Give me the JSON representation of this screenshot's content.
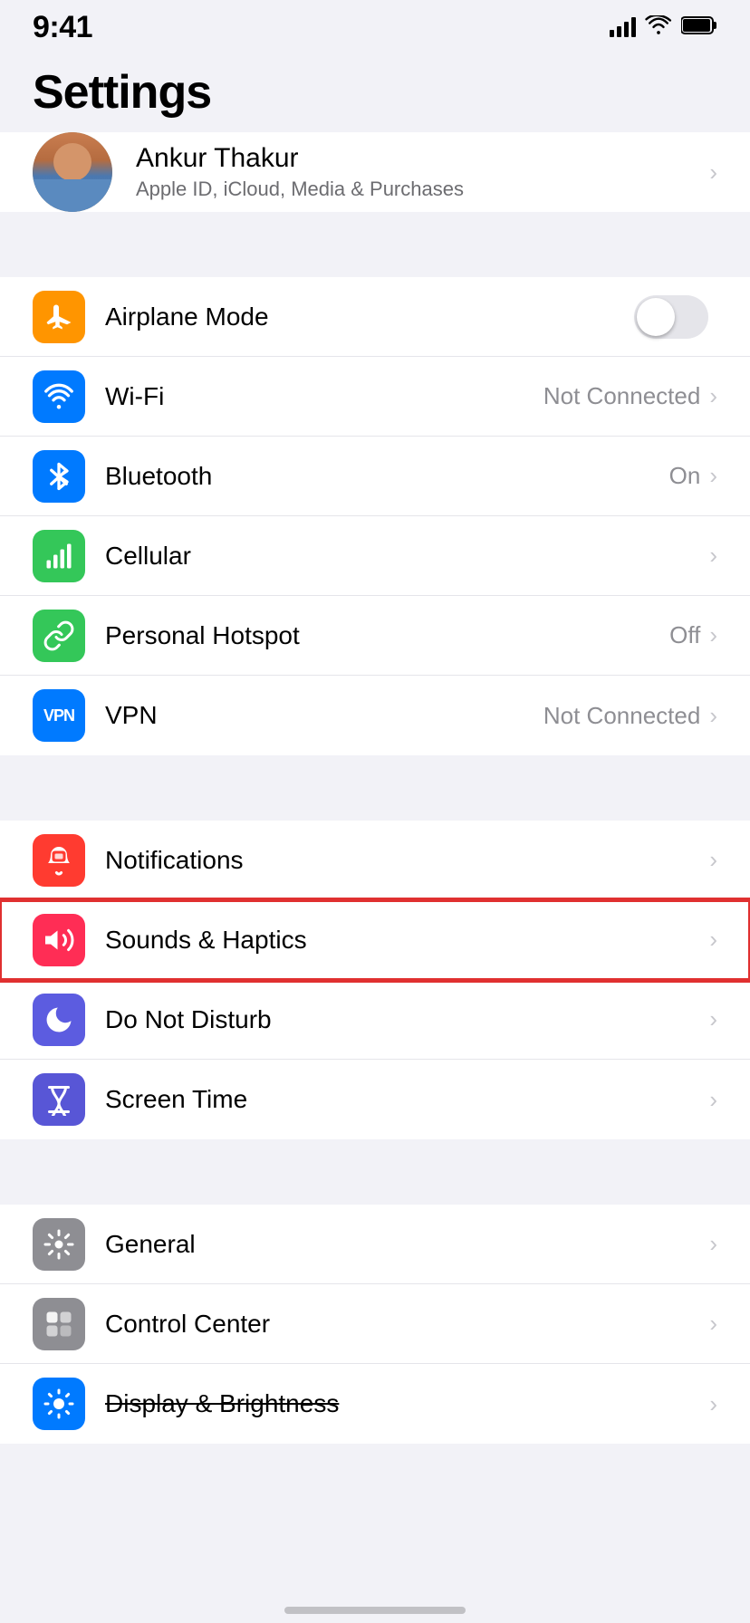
{
  "statusBar": {
    "time": "9:41",
    "signal": 4,
    "wifi": true,
    "battery": "full"
  },
  "pageTitle": "Settings",
  "profile": {
    "name": "Ankur Thakur",
    "subtitle": "Apple ID, iCloud, Media & Purchases"
  },
  "networkSection": {
    "items": [
      {
        "id": "airplane-mode",
        "label": "Airplane Mode",
        "iconBg": "bg-orange",
        "iconType": "airplane",
        "value": "",
        "hasToggle": true,
        "toggleOn": false,
        "hasChevron": false
      },
      {
        "id": "wifi",
        "label": "Wi-Fi",
        "iconBg": "bg-blue",
        "iconType": "wifi",
        "value": "Not Connected",
        "hasToggle": false,
        "toggleOn": false,
        "hasChevron": true
      },
      {
        "id": "bluetooth",
        "label": "Bluetooth",
        "iconBg": "bg-blue-dark",
        "iconType": "bluetooth",
        "value": "On",
        "hasToggle": false,
        "toggleOn": false,
        "hasChevron": true
      },
      {
        "id": "cellular",
        "label": "Cellular",
        "iconBg": "bg-green",
        "iconType": "cellular",
        "value": "",
        "hasToggle": false,
        "toggleOn": false,
        "hasChevron": true
      },
      {
        "id": "personal-hotspot",
        "label": "Personal Hotspot",
        "iconBg": "bg-green",
        "iconType": "hotspot",
        "value": "Off",
        "hasToggle": false,
        "toggleOn": false,
        "hasChevron": true
      },
      {
        "id": "vpn",
        "label": "VPN",
        "iconBg": "bg-blue-vpn",
        "iconType": "vpn",
        "value": "Not Connected",
        "hasToggle": false,
        "toggleOn": false,
        "hasChevron": true
      }
    ]
  },
  "notifSection": {
    "items": [
      {
        "id": "notifications",
        "label": "Notifications",
        "iconBg": "bg-red",
        "iconType": "notifications",
        "value": "",
        "hasChevron": true,
        "highlighted": false
      },
      {
        "id": "sounds-haptics",
        "label": "Sounds & Haptics",
        "iconBg": "bg-pink",
        "iconType": "sounds",
        "value": "",
        "hasChevron": true,
        "highlighted": true
      },
      {
        "id": "do-not-disturb",
        "label": "Do Not Disturb",
        "iconBg": "bg-indigo",
        "iconType": "dnd",
        "value": "",
        "hasChevron": true,
        "highlighted": false
      },
      {
        "id": "screen-time",
        "label": "Screen Time",
        "iconBg": "bg-purple2",
        "iconType": "screentime",
        "value": "",
        "hasChevron": true,
        "highlighted": false
      }
    ]
  },
  "generalSection": {
    "items": [
      {
        "id": "general",
        "label": "General",
        "iconBg": "bg-gray",
        "iconType": "general",
        "value": "",
        "hasChevron": true
      },
      {
        "id": "control-center",
        "label": "Control Center",
        "iconBg": "bg-gray",
        "iconType": "controlcenter",
        "value": "",
        "hasChevron": true
      },
      {
        "id": "display-brightness",
        "label": "Display & Brightness",
        "iconBg": "bg-blue2",
        "iconType": "display",
        "value": "",
        "hasChevron": true,
        "strikethrough": true
      }
    ]
  }
}
